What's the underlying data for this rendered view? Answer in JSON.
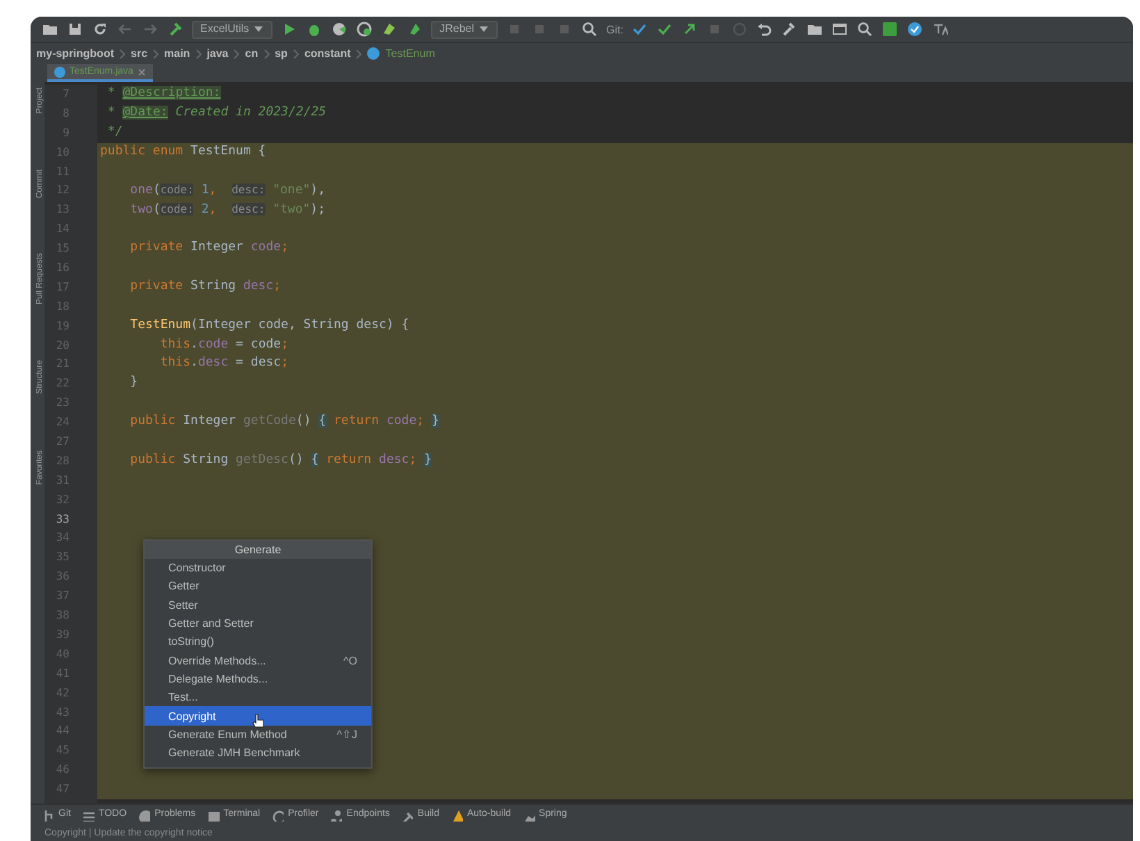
{
  "toolbar": {
    "run_config": "ExcelUtils",
    "jrebel": "JRebel",
    "git_label": "Git:"
  },
  "breadcrumb": [
    "my-springboot",
    "src",
    "main",
    "java",
    "cn",
    "sp",
    "constant",
    "TestEnum"
  ],
  "editor_tabs": [
    {
      "label": "TestEnum.java",
      "selected": true
    }
  ],
  "side_tools": [
    "Project",
    "Commit",
    "Pull Requests",
    "Structure",
    "Favorites"
  ],
  "code": [
    {
      "num": "7",
      "highlighted": false,
      "current": false,
      "tokens": [
        {
          "t": " * ",
          "kind": "doc"
        },
        {
          "t": "@Description:",
          "kind": "doctag"
        }
      ]
    },
    {
      "num": "8",
      "highlighted": false,
      "current": false,
      "tokens": [
        {
          "t": " * ",
          "kind": "doc"
        },
        {
          "t": "@Date:",
          "kind": "doctag"
        },
        {
          "t": " Created in 2023/2/25",
          "kind": "doc"
        }
      ]
    },
    {
      "num": "9",
      "highlighted": false,
      "current": false,
      "tokens": [
        {
          "t": " */",
          "kind": "doc"
        }
      ]
    },
    {
      "num": "10",
      "highlighted": true,
      "current": false,
      "tokens": [
        {
          "t": "public enum ",
          "kind": "kw"
        },
        {
          "t": "TestEnum",
          "kind": "plain"
        },
        {
          "t": " {",
          "kind": "plain"
        }
      ]
    },
    {
      "num": "11",
      "highlighted": true,
      "current": false
    },
    {
      "num": "12",
      "highlighted": true,
      "current": false,
      "tokens": [
        {
          "t": "    one",
          "kind": "field"
        },
        {
          "t": "(",
          "kind": "plain"
        },
        {
          "t": "code:",
          "kind": "hint"
        },
        {
          "t": " 1",
          "kind": "num"
        },
        {
          "t": ",  ",
          "kind": "kw"
        },
        {
          "t": "desc:",
          "kind": "hint"
        },
        {
          "t": " \"one\"",
          "kind": "str"
        },
        {
          "t": "),",
          "kind": "plain"
        }
      ]
    },
    {
      "num": "13",
      "highlighted": true,
      "current": false,
      "tokens": [
        {
          "t": "    two",
          "kind": "field"
        },
        {
          "t": "(",
          "kind": "plain"
        },
        {
          "t": "code:",
          "kind": "hint"
        },
        {
          "t": " 2",
          "kind": "num"
        },
        {
          "t": ",  ",
          "kind": "kw"
        },
        {
          "t": "desc:",
          "kind": "hint"
        },
        {
          "t": " \"two\"",
          "kind": "str"
        },
        {
          "t": ");",
          "kind": "plain"
        }
      ]
    },
    {
      "num": "14",
      "highlighted": true,
      "current": false
    },
    {
      "num": "15",
      "highlighted": true,
      "current": false,
      "tokens": [
        {
          "t": "    private ",
          "kind": "kw"
        },
        {
          "t": "Integer ",
          "kind": "plain"
        },
        {
          "t": "code",
          "kind": "field"
        },
        {
          "t": ";",
          "kind": "kw"
        }
      ]
    },
    {
      "num": "16",
      "highlighted": true,
      "current": false
    },
    {
      "num": "17",
      "highlighted": true,
      "current": false,
      "tokens": [
        {
          "t": "    private ",
          "kind": "kw"
        },
        {
          "t": "String ",
          "kind": "plain"
        },
        {
          "t": "desc",
          "kind": "field"
        },
        {
          "t": ";",
          "kind": "kw"
        }
      ]
    },
    {
      "num": "18",
      "highlighted": true,
      "current": false
    },
    {
      "num": "19",
      "highlighted": true,
      "current": false,
      "tokens": [
        {
          "t": "    TestEnum",
          "kind": "method"
        },
        {
          "t": "(Integer code, String desc) {",
          "kind": "plain"
        }
      ]
    },
    {
      "num": "20",
      "highlighted": true,
      "current": false,
      "tokens": [
        {
          "t": "        this",
          "kind": "kw"
        },
        {
          "t": ".",
          "kind": "plain"
        },
        {
          "t": "code",
          "kind": "field"
        },
        {
          "t": " = code",
          "kind": "plain"
        },
        {
          "t": ";",
          "kind": "kw"
        }
      ]
    },
    {
      "num": "21",
      "highlighted": true,
      "current": false,
      "tokens": [
        {
          "t": "        this",
          "kind": "kw"
        },
        {
          "t": ".",
          "kind": "plain"
        },
        {
          "t": "desc",
          "kind": "field"
        },
        {
          "t": " = desc",
          "kind": "plain"
        },
        {
          "t": ";",
          "kind": "kw"
        }
      ]
    },
    {
      "num": "22",
      "highlighted": true,
      "current": false,
      "tokens": [
        {
          "t": "    }",
          "kind": "plain"
        }
      ]
    },
    {
      "num": "23",
      "highlighted": true,
      "current": false
    },
    {
      "num": "24",
      "highlighted": true,
      "current": false,
      "tokens": [
        {
          "t": "    public ",
          "kind": "kw"
        },
        {
          "t": "Integer ",
          "kind": "plain"
        },
        {
          "t": "getCode",
          "kind": "dim"
        },
        {
          "t": "() ",
          "kind": "plain"
        },
        {
          "t": "{",
          "kind": "brace"
        },
        {
          "t": " return ",
          "kind": "kw"
        },
        {
          "t": "code",
          "kind": "field"
        },
        {
          "t": "; ",
          "kind": "kw"
        },
        {
          "t": "}",
          "kind": "brace"
        }
      ]
    },
    {
      "num": "27",
      "highlighted": true,
      "current": false
    },
    {
      "num": "28",
      "highlighted": true,
      "current": false,
      "tokens": [
        {
          "t": "    public ",
          "kind": "kw"
        },
        {
          "t": "String ",
          "kind": "plain"
        },
        {
          "t": "getDesc",
          "kind": "dim"
        },
        {
          "t": "() ",
          "kind": "plain"
        },
        {
          "t": "{",
          "kind": "brace"
        },
        {
          "t": " return ",
          "kind": "kw"
        },
        {
          "t": "desc",
          "kind": "field"
        },
        {
          "t": "; ",
          "kind": "kw"
        },
        {
          "t": "}",
          "kind": "brace"
        }
      ]
    },
    {
      "num": "31",
      "highlighted": true,
      "current": false
    },
    {
      "num": "32",
      "highlighted": true,
      "current": false
    },
    {
      "num": "33",
      "highlighted": true,
      "current": true
    },
    {
      "num": "34",
      "highlighted": true,
      "current": false
    },
    {
      "num": "35",
      "highlighted": true,
      "current": false
    },
    {
      "num": "36",
      "highlighted": true,
      "current": false
    },
    {
      "num": "37",
      "highlighted": true,
      "current": false
    },
    {
      "num": "38",
      "highlighted": true,
      "current": false
    },
    {
      "num": "39",
      "highlighted": true,
      "current": false
    },
    {
      "num": "40",
      "highlighted": true,
      "current": false
    },
    {
      "num": "41",
      "highlighted": true,
      "current": false
    },
    {
      "num": "42",
      "highlighted": true,
      "current": false
    },
    {
      "num": "43",
      "highlighted": true,
      "current": false
    },
    {
      "num": "44",
      "highlighted": true,
      "current": false
    },
    {
      "num": "45",
      "highlighted": true,
      "current": false
    },
    {
      "num": "46",
      "highlighted": true,
      "current": false
    },
    {
      "num": "47",
      "highlighted": true,
      "current": false
    }
  ],
  "generate_menu": {
    "title": "Generate",
    "items": [
      {
        "label": "Constructor",
        "selected": false
      },
      {
        "label": "Getter",
        "selected": false
      },
      {
        "label": "Setter",
        "selected": false
      },
      {
        "label": "Getter and Setter",
        "selected": false
      },
      {
        "label": "toString()",
        "selected": false
      },
      {
        "label": "Override Methods...",
        "shortcut": "^O",
        "selected": false
      },
      {
        "label": "Delegate Methods...",
        "selected": false
      },
      {
        "label": "Test...",
        "selected": false
      },
      {
        "label": "Copyright",
        "selected": true
      },
      {
        "label": "Generate Enum Method",
        "shortcut": "^⇧J",
        "selected": false
      },
      {
        "label": "Generate JMH Benchmark",
        "selected": false
      }
    ]
  },
  "tool_windows": [
    {
      "label": "Git"
    },
    {
      "label": "TODO"
    },
    {
      "label": "Problems"
    },
    {
      "label": "Terminal"
    },
    {
      "label": "Profiler"
    },
    {
      "label": "Endpoints"
    },
    {
      "label": "Build"
    },
    {
      "label": "Auto-build"
    },
    {
      "label": "Spring"
    }
  ],
  "status_bar": {
    "message": "Copyright | Update the copyright notice"
  }
}
